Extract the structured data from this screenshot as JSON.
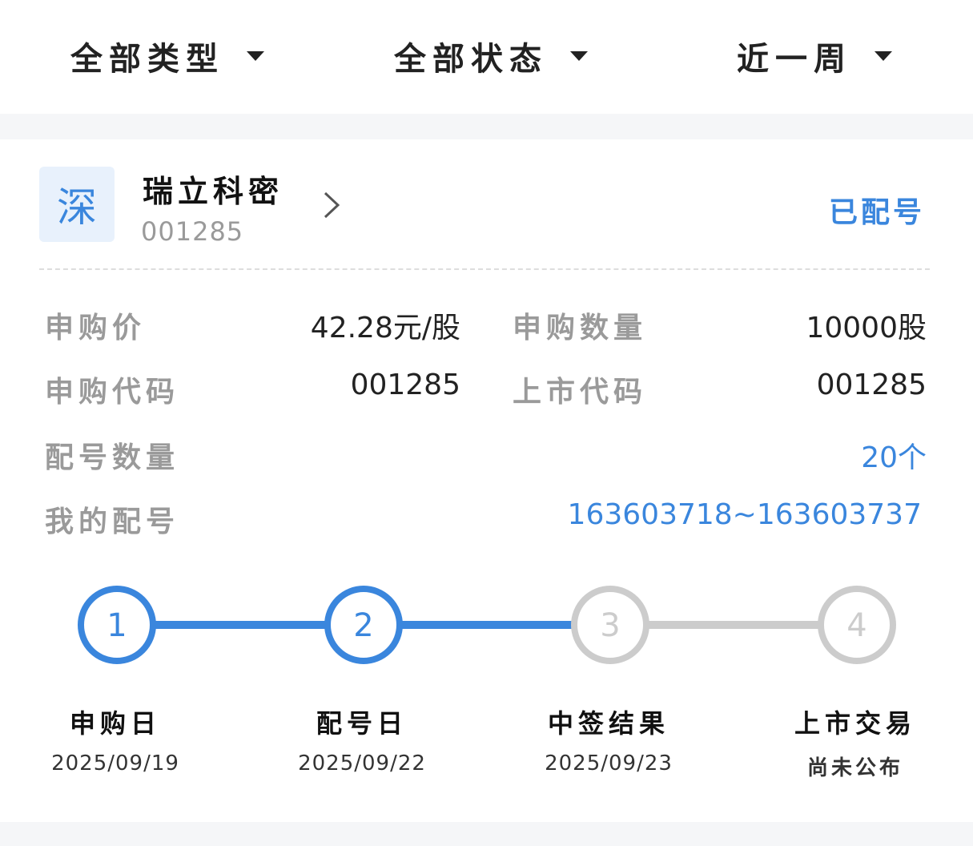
{
  "filters": [
    {
      "label": "全部类型"
    },
    {
      "label": "全部状态"
    },
    {
      "label": "近一周"
    }
  ],
  "card": {
    "market": "深",
    "stock_name": "瑞立科密",
    "stock_code": "001285",
    "status": "已配号",
    "chevron_icon": "chevron-right-icon",
    "info": {
      "price_label": "申购价",
      "price_value": "42.28元/股",
      "quantity_label": "申购数量",
      "quantity_value": "10000股",
      "sub_code_label": "申购代码",
      "sub_code_value": "001285",
      "list_code_label": "上市代码",
      "list_code_value": "001285",
      "alloc_count_label": "配号数量",
      "alloc_count_value": "20个",
      "my_alloc_label": "我的配号",
      "my_alloc_value": "163603718~163603737"
    },
    "steps": [
      {
        "num": "1",
        "title": "申购日",
        "sub": "2025/09/19",
        "done": true
      },
      {
        "num": "2",
        "title": "配号日",
        "sub": "2025/09/22",
        "done": true
      },
      {
        "num": "3",
        "title": "中签结果",
        "sub": "2025/09/23",
        "done": false
      },
      {
        "num": "4",
        "title": "上市交易",
        "sub": "尚未公布",
        "done": false
      }
    ]
  },
  "colors": {
    "accent": "#3a86dd",
    "inactive": "#cccccc"
  }
}
